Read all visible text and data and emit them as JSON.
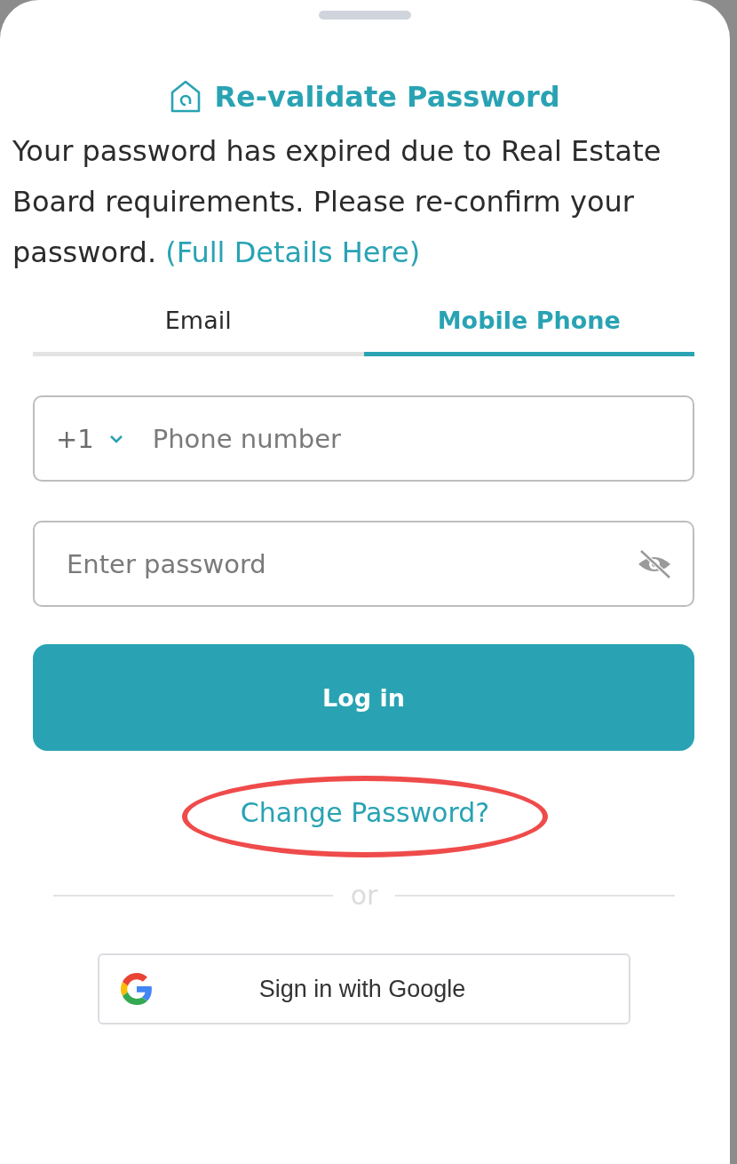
{
  "title": "Re-validate Password",
  "message": {
    "text": "Your password has expired due to Real Estate Board requirements. Please re-confirm your password.",
    "link": "(Full Details Here)"
  },
  "tabs": [
    {
      "label": "Email",
      "selected": false
    },
    {
      "label": "Mobile Phone",
      "selected": true
    }
  ],
  "phone_field": {
    "country_code": "+1",
    "placeholder": "Phone number"
  },
  "password_field": {
    "placeholder": "Enter password"
  },
  "login_button": "Log in",
  "change_password_link": {
    "label": "Change Password?",
    "highlighted": true
  },
  "divider_text": "or",
  "google_button": "Sign in with Google"
}
